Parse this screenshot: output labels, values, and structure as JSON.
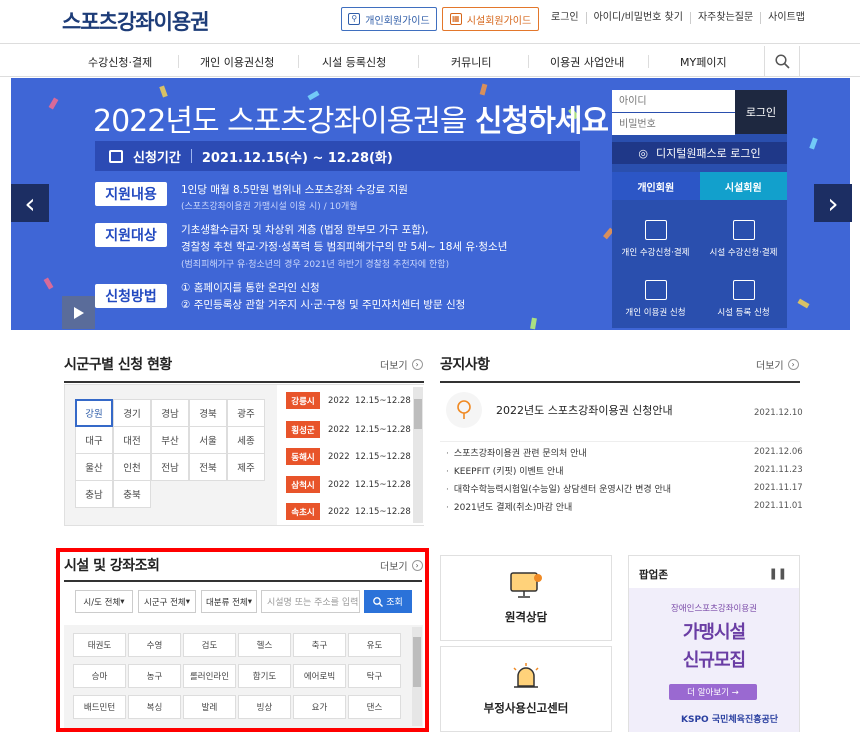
{
  "header": {
    "logo": "스포츠강좌이용권",
    "guide_personal": "개인회원가이드",
    "guide_facility": "시설회원가이드",
    "util_links": [
      "로그인",
      "아이디/비밀번호 찾기",
      "자주찾는질문",
      "사이트맵"
    ]
  },
  "gnb": {
    "items": [
      "수강신청·결제",
      "개인 이용권신청",
      "시설 등록신청",
      "커뮤니티",
      "이용권 사업안내",
      "MY페이지"
    ]
  },
  "banner": {
    "title_pre": "2022년도 스포츠강좌이용권을 ",
    "title_bold": "신청하세요",
    "period_label": "신청기간",
    "period_value": "2021.12.15(수) ~ 12.28(화)",
    "support_content_label": "지원내용",
    "support_content_line1": "1인당 매월 8.5만원 범위내 스포츠강좌 수강료 지원",
    "support_content_line2": "(스포츠강좌이용권 가맹시설 이용 시) / 10개월",
    "support_target_label": "지원대상",
    "support_target_line1": "기초생활수급자 및 차상위 계층 (법정 한부모 가구 포함),",
    "support_target_line2": "경찰청 추천 학교·가정·성폭력 등 범죄피해가구의 만 5세~ 18세 유·청소년",
    "support_target_line3": "(범죄피해가구 유·청소년의 경우 2021년 하반기 경찰청 추천자에 한함)",
    "method_label": "신청방법",
    "method_line1": "① 홈페이지를 통한 온라인 신청",
    "method_line2": "② 주민등록상 관할 거주지 시·군·구청 및 주민자치센터 방문 신청"
  },
  "login": {
    "id_placeholder": "아이디",
    "pw_placeholder": "비밀번호",
    "login_button": "로그인",
    "digital_login": "디지털원패스로 로그인",
    "tab_personal": "개인회원",
    "tab_facility": "시설회원",
    "quick": [
      "개인 수강신청·결제",
      "시설 수강신청·결제",
      "개인 이용권 신청",
      "시설 등록 신청"
    ]
  },
  "region": {
    "title": "시군구별 신청 현황",
    "more": "더보기",
    "regions": [
      "강원",
      "경기",
      "경남",
      "경북",
      "광주",
      "대구",
      "대전",
      "부산",
      "서울",
      "세종",
      "울산",
      "인천",
      "전남",
      "전북",
      "제주",
      "충남",
      "충북"
    ],
    "applications": [
      {
        "city": "강릉시",
        "year": "2022",
        "range": "12.15~12.28"
      },
      {
        "city": "횡성군",
        "year": "2022",
        "range": "12.15~12.28"
      },
      {
        "city": "동해시",
        "year": "2022",
        "range": "12.15~12.28"
      },
      {
        "city": "삼척시",
        "year": "2022",
        "range": "12.15~12.28"
      },
      {
        "city": "속초시",
        "year": "2022",
        "range": "12.15~12.28"
      }
    ]
  },
  "notice": {
    "title": "공지사항",
    "more": "더보기",
    "top_title": "2022년도 스포츠강좌이용권 신청안내",
    "top_date": "2021.12.10",
    "items": [
      {
        "text": "스포츠강좌이용권 관련 문의처 안내",
        "date": "2021.12.06"
      },
      {
        "text": "KEEPFIT (키핏) 이벤트 안내",
        "date": "2021.11.23"
      },
      {
        "text": "대학수학능력시험일(수능일) 상담센터 운영시간 변경 안내",
        "date": "2021.11.17"
      },
      {
        "text": "2021년도 결제(취소)마감 안내",
        "date": "2021.11.01"
      }
    ]
  },
  "facility": {
    "title": "시설 및 강좌조회",
    "more": "더보기",
    "select_sido": "시/도 전체",
    "select_sigungu": "시군구 전체",
    "select_category": "대분류 전체",
    "search_placeholder": "시설명 또는 주소를 입력",
    "search_button": "조회",
    "sports": [
      "태권도",
      "수영",
      "검도",
      "헬스",
      "축구",
      "유도",
      "승마",
      "농구",
      "롤러인라인",
      "합기도",
      "에어로빅",
      "탁구",
      "배드민턴",
      "복싱",
      "발레",
      "빙상",
      "요가",
      "댄스"
    ]
  },
  "cards": {
    "remote": "원격상담",
    "report": "부정사용신고센터"
  },
  "popup": {
    "title": "팝업존",
    "subtitle": "장애인스포츠강좌이용권",
    "big1": "가맹시설",
    "big2": "신규모집",
    "more": "더 알아보기 →",
    "org": "KSPO 국민체육진흥공단"
  },
  "colors": {
    "brand": "#1d3c78",
    "banner": "#3f66d6",
    "accent_orange": "#e8542a",
    "highlight": "#ff0000"
  }
}
